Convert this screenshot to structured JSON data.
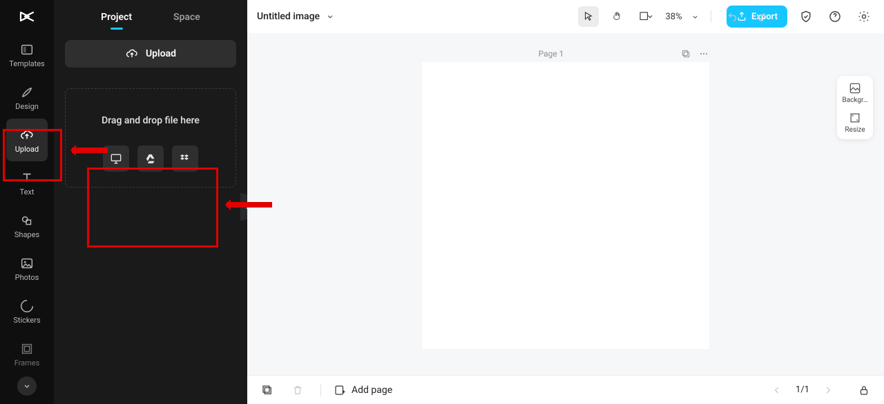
{
  "nav": {
    "templates": "Templates",
    "design": "Design",
    "upload": "Upload",
    "text": "Text",
    "shapes": "Shapes",
    "photos": "Photos",
    "stickers": "Stickers",
    "frames": "Frames"
  },
  "panel": {
    "tab_project": "Project",
    "tab_space": "Space",
    "upload_button": "Upload",
    "drop_text": "Drag and drop file here"
  },
  "header": {
    "doc_title": "Untitled image",
    "zoom": "38%",
    "export": "Export"
  },
  "canvas": {
    "page_label": "Page 1"
  },
  "dock": {
    "background": "Backgr…",
    "resize": "Resize"
  },
  "footer": {
    "add_page": "Add page",
    "counter": "1/1"
  }
}
